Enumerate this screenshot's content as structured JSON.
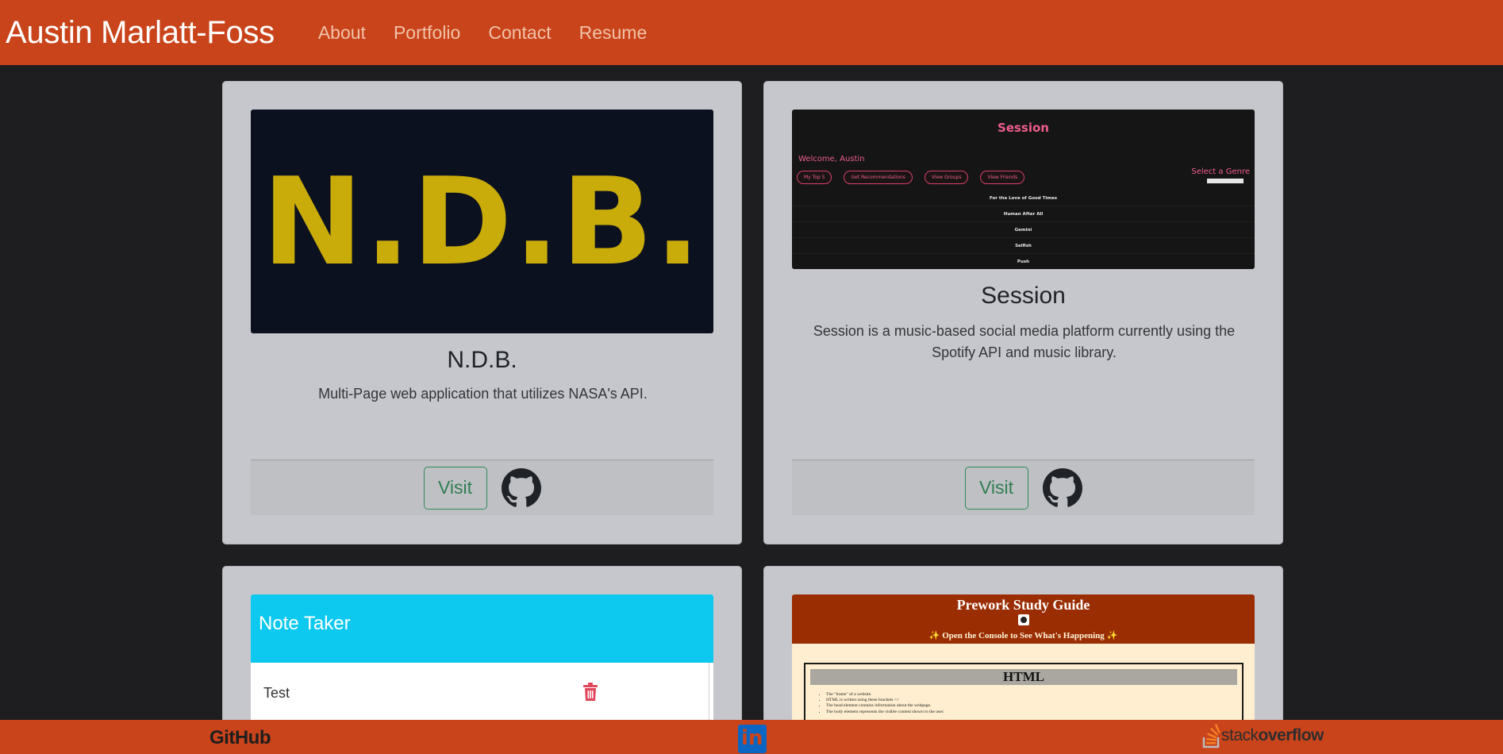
{
  "header": {
    "brand": "Austin Marlatt-Foss",
    "nav": [
      "About",
      "Portfolio",
      "Contact",
      "Resume"
    ]
  },
  "cards": [
    {
      "logo_text": "N.D.B.",
      "title": "N.D.B.",
      "description": "Multi-Page web application that utilizes NASA's API.",
      "visit_label": "Visit"
    },
    {
      "title": "Session",
      "description": "Session is a music-based social media platform currently using the Spotify API and music library.",
      "visit_label": "Visit",
      "preview": {
        "title": "Session",
        "welcome": "Welcome, Austin",
        "genre_label": "Select a Genre",
        "buttons": [
          "My Top 5",
          "Get Recommendations",
          "View Groups",
          "View Friends"
        ],
        "tracks": [
          "For the Love of Good Times",
          "Human After All",
          "Gemini",
          "Selfish",
          "Push"
        ]
      }
    },
    {
      "preview": {
        "header": "Note Taker",
        "note": "Test"
      }
    },
    {
      "preview": {
        "title": "Prework Study Guide",
        "subtitle": "✨ Open the Console to See What's Happening ✨",
        "section": "HTML",
        "bullets": [
          "The \"frame\" of a website.",
          "HTML is written using these brackets <>",
          "The head element contains information about the webpage.",
          "The body element represents the visible content shown to the user."
        ]
      }
    }
  ],
  "footer": {
    "github": "GitHub",
    "linkedin": "in",
    "stackoverflow_light": "stack",
    "stackoverflow_bold": "overflow"
  },
  "colors": {
    "header_bg": "#c9441b",
    "page_bg": "#1e1e20",
    "card_bg": "#c6c7cc",
    "visit_green": "#2f7e52"
  }
}
